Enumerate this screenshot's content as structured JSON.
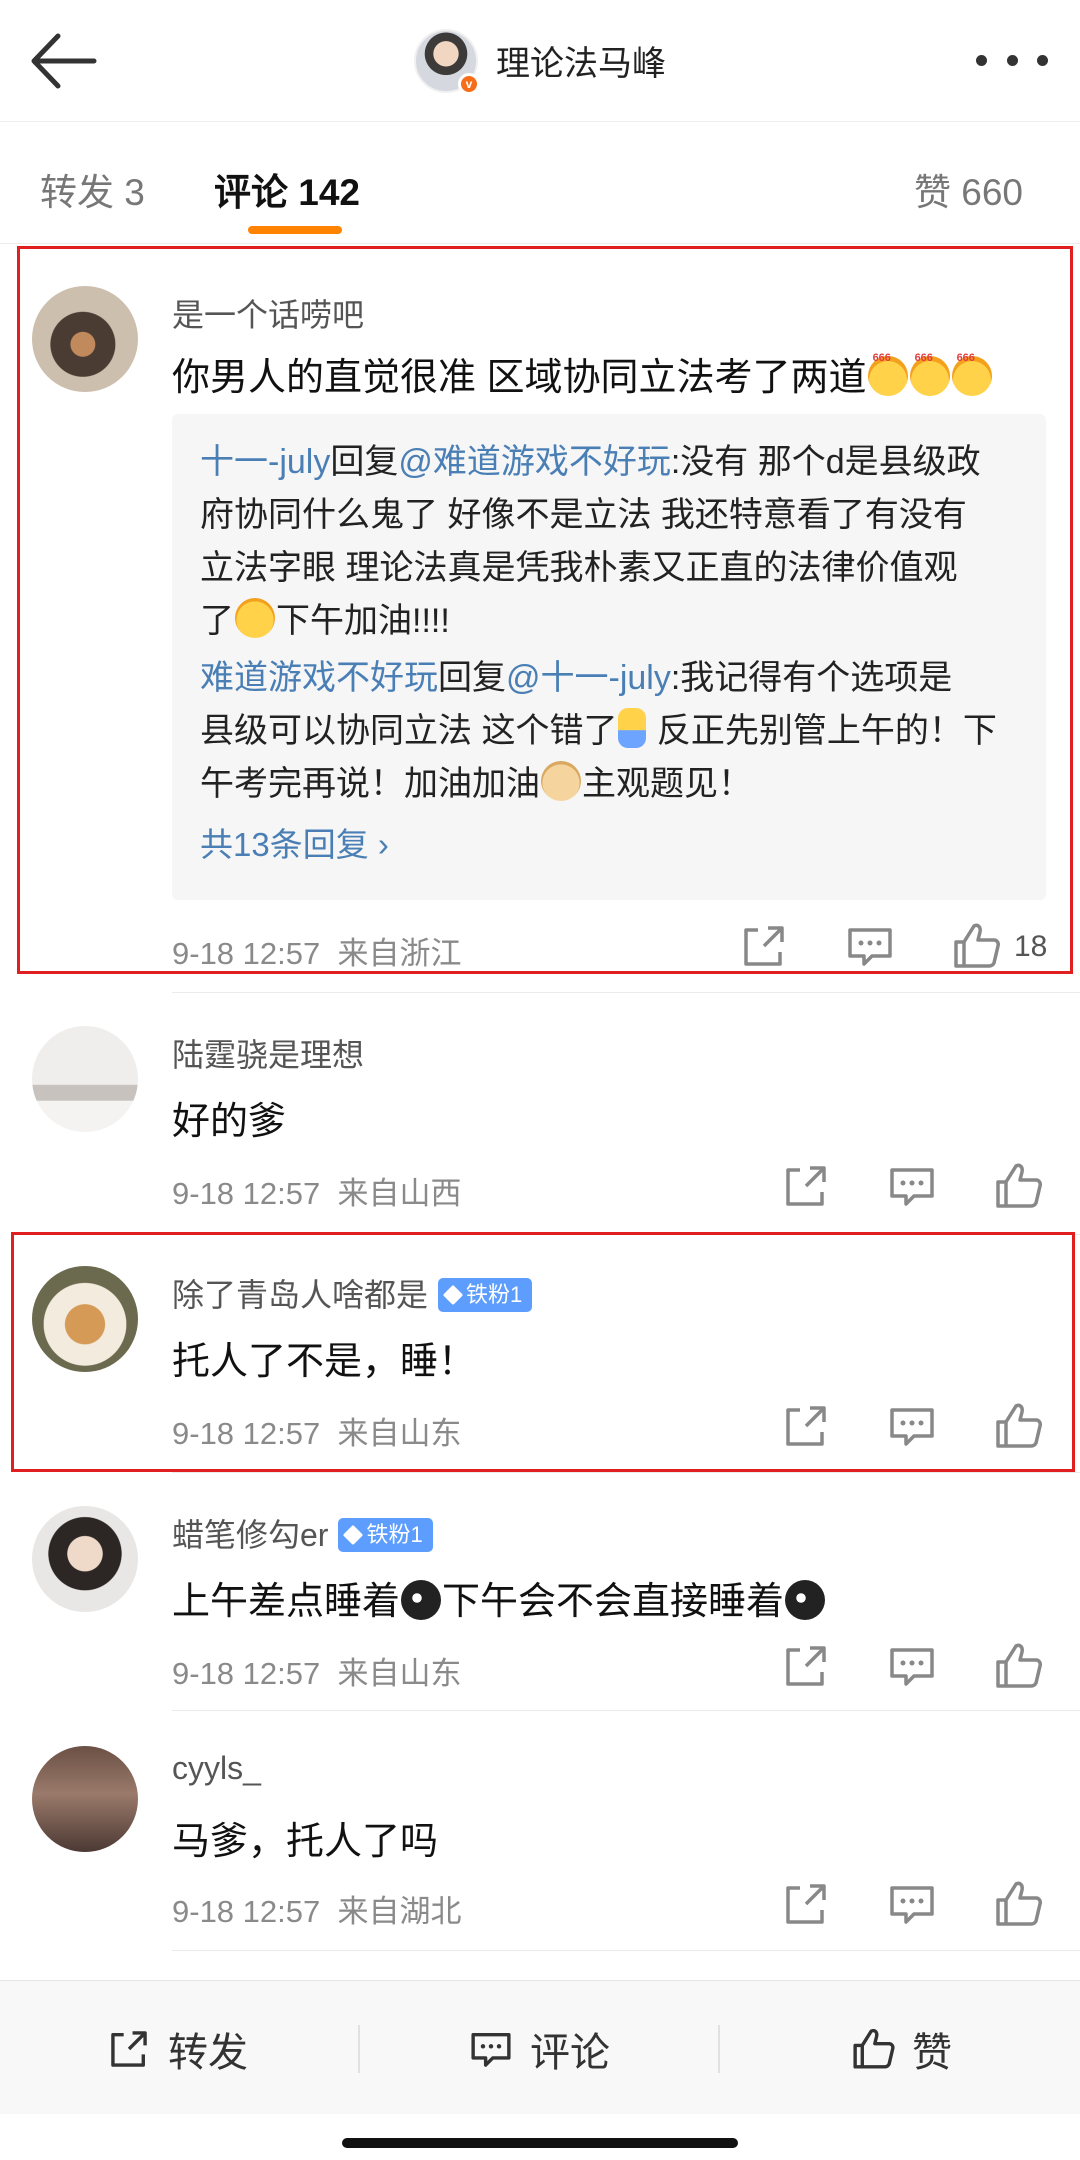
{
  "header": {
    "title": "理论法马峰",
    "back_icon": "arrow-left-icon",
    "more_icon": "more-dots-icon"
  },
  "tabs": {
    "repost": "转发 3",
    "comments": "评论 142",
    "likes": "赞 660",
    "accent_color": "#ff8200"
  },
  "comments": [
    {
      "username": "是一个话唠吧",
      "text": "你男人的直觉很准 区域协同立法考了两道",
      "replies": [
        {
          "from": "十一-july",
          "reply_word": "回复",
          "to": "@难道游戏不好玩",
          "content_1": ":没有 那个d是县级政",
          "content_2": "府协同什么鬼了 好像不是立法 我还特意看了有没有",
          "content_3": "立法字眼 理论法真是凭我朴素又正直的法律价值观",
          "content_4a": "了",
          "content_4b": "下午加油!!!!"
        },
        {
          "from": "难道游戏不好玩",
          "reply_word": "回复",
          "to": "@十一-july",
          "content_1": ":我记得有个选项是",
          "content_2a": "县级可以协同立法 这个错了",
          "content_2b": " 反正先别管上午的！下",
          "content_3a": "午考完再说！加油加油",
          "content_3b": "主观题见！"
        }
      ],
      "more_replies": "共13条回复 ›",
      "time": "9-18 12:57",
      "location": "来自浙江",
      "like_count": "18"
    },
    {
      "username": "陆霆骁是理想",
      "text": "好的爹",
      "time": "9-18 12:57",
      "location": "来自山西"
    },
    {
      "username": "除了青岛人啥都是",
      "badge": "铁粉1",
      "text": "托人了不是，睡！",
      "time": "9-18 12:57",
      "location": "来自山东"
    },
    {
      "username": "蜡笔修勾er",
      "badge": "铁粉1",
      "text_a": "上午差点睡着",
      "text_b": "下午会不会直接睡着",
      "time": "9-18 12:57",
      "location": "来自山东"
    },
    {
      "username": "cyyls_",
      "text": "马爹，托人了吗",
      "time": "9-18 12:57",
      "location": "来自湖北"
    }
  ],
  "bottom_bar": {
    "repost": "转发",
    "comment": "评论",
    "like": "赞"
  },
  "colors": {
    "link_blue": "#4a7fb5",
    "badge_blue": "#5d9dfd",
    "highlight_red": "#e02020"
  }
}
